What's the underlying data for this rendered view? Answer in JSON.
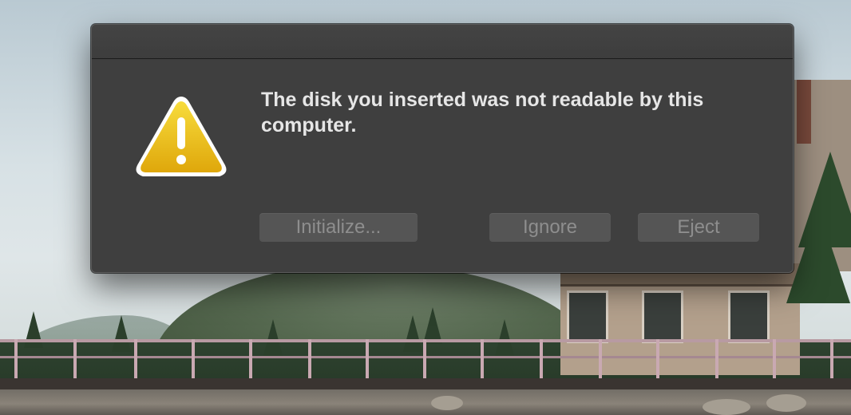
{
  "dialog": {
    "icon": "warning-triangle-icon",
    "message": "The disk you inserted was not readable by this computer.",
    "buttons": {
      "initialize": "Initialize...",
      "ignore": "Ignore",
      "eject": "Eject"
    }
  },
  "colors": {
    "dialog_bg": "#3f3f3f",
    "button_bg": "#555555",
    "button_text": "#8e8e8e",
    "message_text": "#e6e6e6",
    "warning_yellow": "#f1c40f"
  }
}
